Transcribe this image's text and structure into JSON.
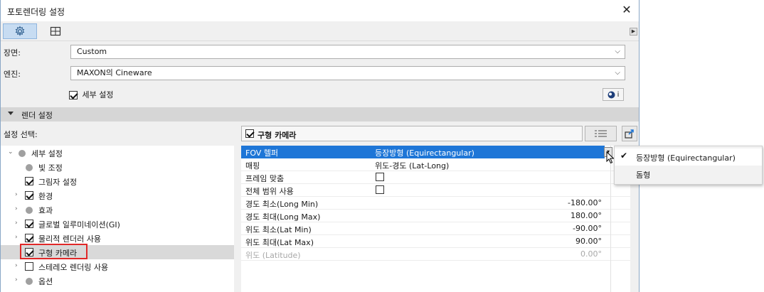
{
  "window": {
    "title": "포토렌더링 설정"
  },
  "tabs": [
    {
      "icon": "gear-icon",
      "active": true
    },
    {
      "icon": "grid-icon",
      "active": false
    }
  ],
  "scene": {
    "label": "장면:",
    "value": "Custom"
  },
  "engine": {
    "label": "엔진:",
    "value": "MAXON의 Cineware",
    "info_label": "i"
  },
  "detail": {
    "label": "세부 설정",
    "checked": true
  },
  "section": {
    "label": "렌더 설정"
  },
  "settings_select": {
    "label": "설정 선택:"
  },
  "tree": [
    {
      "label": "세부 설정",
      "kind": "dot",
      "expander": "⌄"
    },
    {
      "label": "빛 조정",
      "kind": "dot",
      "expander": ""
    },
    {
      "label": "그림자 설정",
      "kind": "check",
      "checked": true,
      "expander": ""
    },
    {
      "label": "환경",
      "kind": "check",
      "checked": true,
      "expander": "›"
    },
    {
      "label": "효과",
      "kind": "dot",
      "expander": "›"
    },
    {
      "label": "글로벌 일루미네이션(GI)",
      "kind": "check",
      "checked": true,
      "expander": "›"
    },
    {
      "label": "물리적 렌더러 사용",
      "kind": "check",
      "checked": true,
      "expander": "›"
    },
    {
      "label": "구형 카메라",
      "kind": "check",
      "checked": true,
      "expander": "",
      "selected": true
    },
    {
      "label": "스테레오 렌더링 사용",
      "kind": "check",
      "checked": false,
      "expander": "›"
    },
    {
      "label": "옵션",
      "kind": "dot",
      "expander": "›"
    }
  ],
  "panel_header": {
    "label": "구형 카메라",
    "checked": true
  },
  "properties": [
    {
      "name": "FOV 헬퍼",
      "value": "등장방형 (Equirectangular)",
      "selected": true
    },
    {
      "name": "매핑",
      "value": "위도-경도 (Lat-Long)"
    },
    {
      "name": "프레임 맞춤",
      "checkbox": false
    },
    {
      "name": "전체 범위 사용",
      "checkbox": false
    },
    {
      "name": "경도 최소(Long Min)",
      "number": "-180.00°"
    },
    {
      "name": "경도 최대(Long Max)",
      "number": "180.00°"
    },
    {
      "name": "위도 최소(Lat Min)",
      "number": "-90.00°"
    },
    {
      "name": "위도 최대(Lat Max)",
      "number": "90.00°"
    },
    {
      "name": "위도 (Latitude)",
      "number": "0.00°",
      "dim": true
    }
  ],
  "dropdown_menu": {
    "items": [
      {
        "label": "등장방형 (Equirectangular)",
        "checked": true
      },
      {
        "label": "돔형",
        "checked": false
      }
    ]
  },
  "colors": {
    "selection": "#1e76d7",
    "highlight": "#e02828",
    "tab_active": "#c7dcf2"
  }
}
